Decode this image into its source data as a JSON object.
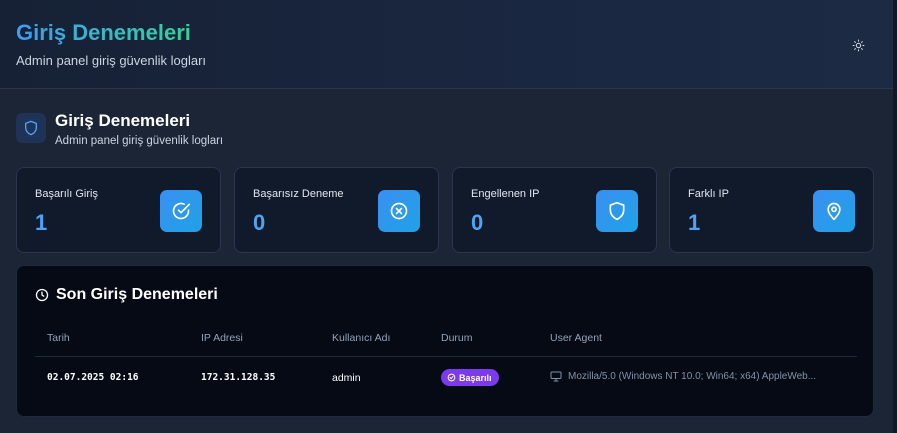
{
  "header": {
    "title": "Giriş Denemeleri",
    "subtitle": "Admin panel giriş güvenlik logları",
    "theme_icon": "sun-icon"
  },
  "section": {
    "title": "Giriş Denemeleri",
    "subtitle": "Admin panel giriş güvenlik logları",
    "icon": "shield-icon"
  },
  "stats": [
    {
      "label": "Başarılı Giriş",
      "value": "1",
      "icon": "check-circle-icon"
    },
    {
      "label": "Başarısız Deneme",
      "value": "0",
      "icon": "x-circle-icon"
    },
    {
      "label": "Engellenen IP",
      "value": "0",
      "icon": "shield-icon"
    },
    {
      "label": "Farklı IP",
      "value": "1",
      "icon": "map-pin-icon"
    }
  ],
  "recent": {
    "title": "Son Giriş Denemeleri",
    "icon": "clock-icon",
    "columns": [
      "Tarih",
      "IP Adresi",
      "Kullanıcı Adı",
      "Durum",
      "User Agent"
    ],
    "rows": [
      {
        "date": "02.07.2025 02:16",
        "ip": "172.31.128.35",
        "username": "admin",
        "status": "Başarılı",
        "user_agent": "Mozilla/5.0 (Windows NT 10.0; Win64; x64) AppleWeb..."
      }
    ]
  },
  "colors": {
    "accent": "#3a8ff2",
    "success_badge": "#7c3aed",
    "title_gradient_start": "#3b9cf5",
    "title_gradient_end": "#34d399"
  }
}
